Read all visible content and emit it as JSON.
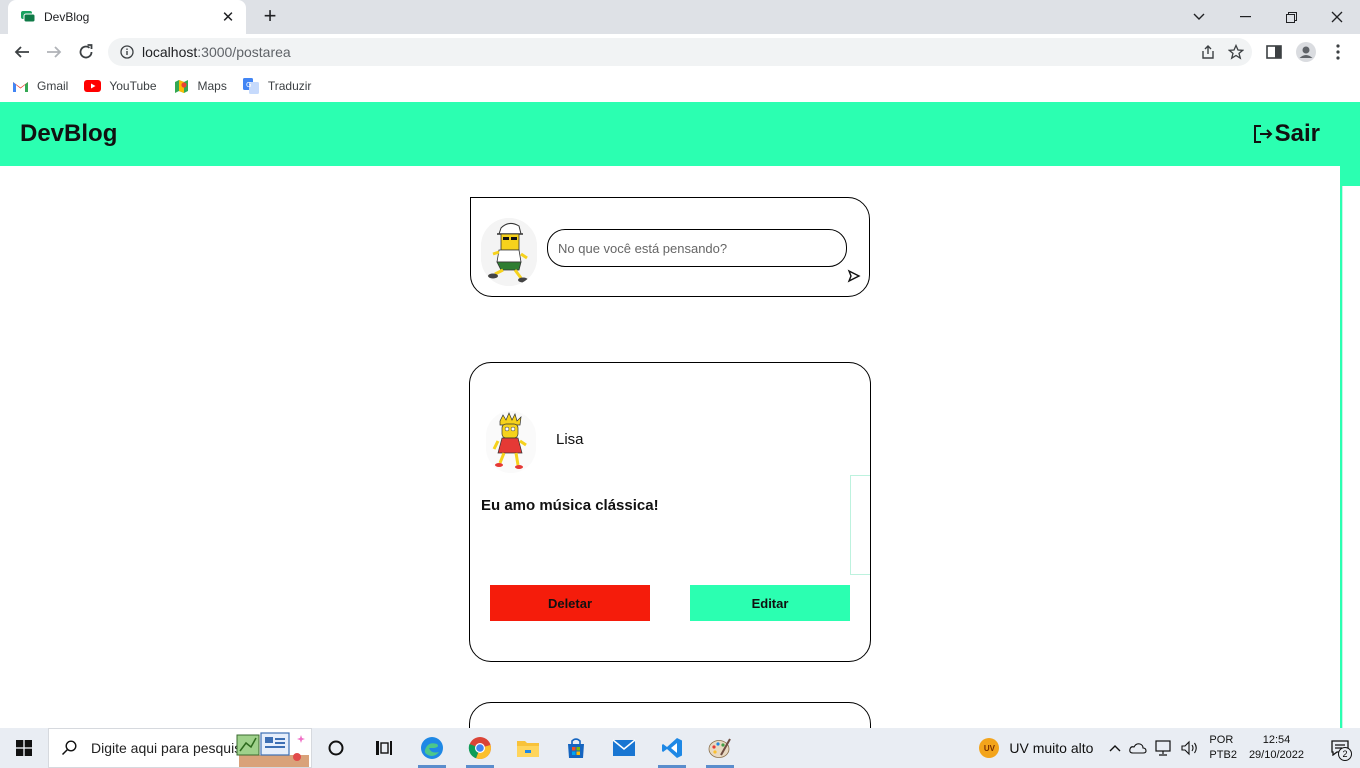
{
  "browser": {
    "tab_title": "DevBlog",
    "new_tab_symbol": "+",
    "url_host": "localhost",
    "url_path": ":3000/postarea",
    "bookmarks": [
      {
        "label": "Gmail",
        "icon": "gmail-icon"
      },
      {
        "label": "YouTube",
        "icon": "youtube-icon"
      },
      {
        "label": "Maps",
        "icon": "maps-icon"
      },
      {
        "label": "Traduzir",
        "icon": "translate-icon"
      }
    ]
  },
  "app": {
    "brand": "DevBlog",
    "logout_label": "Sair",
    "accent_color": "#2bffb1",
    "danger_color": "#f51c0b"
  },
  "composer": {
    "placeholder": "No que você está pensando?"
  },
  "posts": [
    {
      "author": "Lisa",
      "content": "Eu amo música clássica!",
      "delete_label": "Deletar",
      "edit_label": "Editar"
    }
  ],
  "taskbar": {
    "search_placeholder": "Digite aqui para pesquisar",
    "weather": "UV muito alto",
    "weather_badge": "UV",
    "lang_1": "POR",
    "lang_2": "PTB2",
    "time": "12:54",
    "date": "29/10/2022",
    "notification_count": "2"
  }
}
